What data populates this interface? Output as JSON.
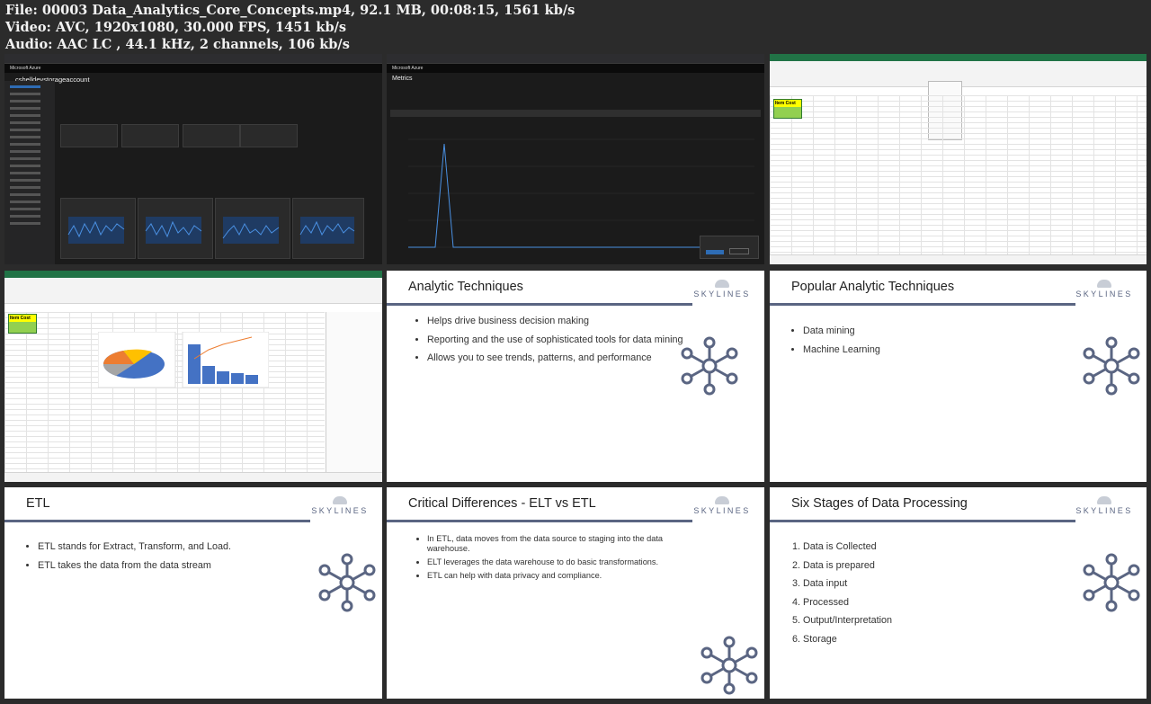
{
  "file_info": {
    "line1": "File: 00003 Data_Analytics_Core_Concepts.mp4, 92.1 MB, 00:08:15, 1561 kb/s",
    "line2": "Video: AVC, 1920x1080, 30.000 FPS, 1451 kb/s",
    "line3": "Audio: AAC LC , 44.1 kHz, 2 channels, 106 kb/s"
  },
  "colors": {
    "accent_rule": "#5a6582",
    "excel_green": "#217346",
    "azure_blue": "#2e6cb4",
    "table_fill": "#92d050",
    "table_header": "#ffff00"
  },
  "frames": {
    "azure_overview": {
      "top_bar": "Microsoft Azure",
      "resource_name": "cshelldevstorageaccount"
    },
    "azure_metrics": {
      "top_bar": "Microsoft Azure",
      "title": "Metrics"
    },
    "excel_blank": {
      "table_header": "Item  Cost"
    },
    "excel_charts": {
      "table_header": "Item  Cost"
    }
  },
  "slides": {
    "analytic_techniques": {
      "title": "Analytic Techniques",
      "bullets": [
        "Helps drive business decision making",
        "Reporting and the use of sophisticated tools for data mining",
        "Allows you to see trends, patterns, and performance"
      ]
    },
    "popular_techniques": {
      "title": "Popular Analytic Techniques",
      "bullets": [
        "Data mining",
        "Machine Learning"
      ]
    },
    "etl": {
      "title": "ETL",
      "bullets": [
        "ETL stands for Extract, Transform, and Load.",
        "ETL takes the data from the data stream"
      ]
    },
    "elt_vs_etl": {
      "title": "Critical Differences - ELT vs ETL",
      "bullets": [
        "In ETL, data moves from the data source to staging into the data warehouse.",
        "ELT leverages the data warehouse to do basic transformations.",
        "ETL can help with data privacy and compliance."
      ]
    },
    "six_stages": {
      "title": "Six Stages of Data Processing",
      "items": [
        "Data is Collected",
        "Data is prepared",
        "Data input",
        "Processed",
        "Output/Interpretation",
        "Storage"
      ]
    }
  },
  "logo": {
    "brand": "SKYLINES",
    "icon": "cloud-icon",
    "hub_icon": "network-hub-icon"
  }
}
